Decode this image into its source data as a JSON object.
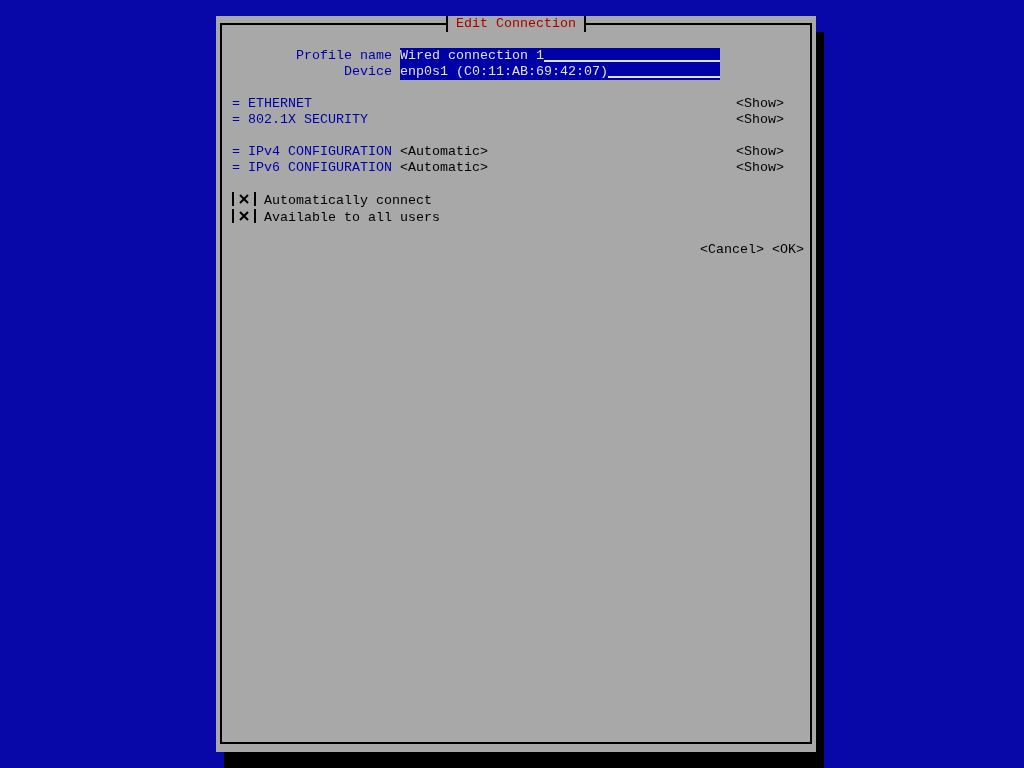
{
  "dialog": {
    "title": "Edit Connection"
  },
  "fields": [
    {
      "label": "Profile name",
      "value": "Wired connection 1"
    },
    {
      "label": "Device",
      "value": "enp0s1 (C0:11:AB:69:42:07)"
    }
  ],
  "section_groups": [
    [
      {
        "marker": "=",
        "label": "ETHERNET",
        "action": "<Show>"
      },
      {
        "marker": "=",
        "label": "802.1X SECURITY",
        "action": "<Show>"
      }
    ],
    [
      {
        "marker": "=",
        "label": "IPv4 CONFIGURATION",
        "value": "<Automatic>",
        "action": "<Show>"
      },
      {
        "marker": "=",
        "label": "IPv6 CONFIGURATION",
        "value": "<Automatic>",
        "action": "<Show>"
      }
    ]
  ],
  "checkboxes": [
    {
      "label": "Automatically connect",
      "checked": true
    },
    {
      "label": "Available to all users",
      "checked": true
    }
  ],
  "buttons": [
    "<Cancel>",
    "<OK>"
  ]
}
